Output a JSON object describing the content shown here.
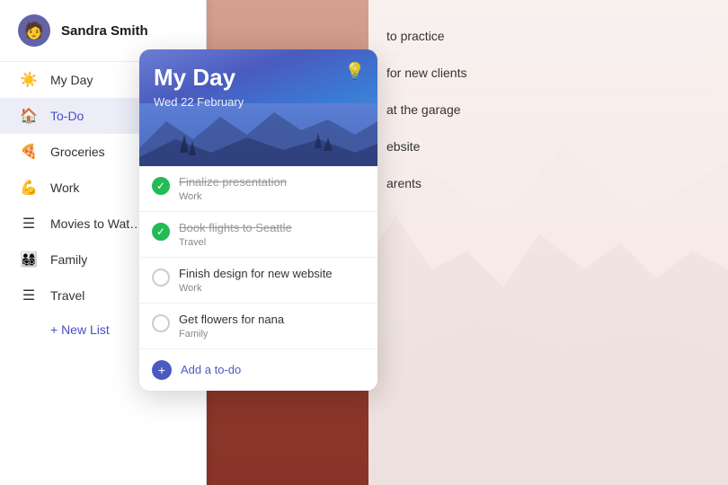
{
  "user": {
    "name": "Sandra Smith",
    "avatar_emoji": "🧑"
  },
  "sidebar": {
    "items": [
      {
        "id": "my-day",
        "label": "My Day",
        "icon": "☀️",
        "active": false
      },
      {
        "id": "to-do",
        "label": "To-Do",
        "icon": "🏠",
        "active": true
      },
      {
        "id": "groceries",
        "label": "Groceries",
        "icon": "🍕",
        "active": false
      },
      {
        "id": "work",
        "label": "Work",
        "icon": "💪",
        "active": false
      },
      {
        "id": "movies-to-watch",
        "label": "Movies to Wat…",
        "icon": "≡",
        "active": false
      },
      {
        "id": "family",
        "label": "Family",
        "icon": "👨‍👩‍👧‍👦",
        "active": false
      },
      {
        "id": "travel",
        "label": "Travel",
        "icon": "≡",
        "active": false
      },
      {
        "id": "new-list",
        "label": "+ New List",
        "icon": "",
        "active": false,
        "special": true
      }
    ]
  },
  "main_bg_tasks": [
    {
      "text": "to practice"
    },
    {
      "text": "for new clients"
    },
    {
      "text": "at the garage"
    },
    {
      "text": "ebsite"
    },
    {
      "text": "arents"
    }
  ],
  "card": {
    "title": "My Day",
    "date": "Wed 22 February",
    "bulb_icon": "💡",
    "tasks": [
      {
        "id": "task-1",
        "text": "Finalize presentation",
        "category": "Work",
        "done": true,
        "strikethrough": true
      },
      {
        "id": "task-2",
        "text": "Book flights to Seattle",
        "category": "Travel",
        "done": true,
        "strikethrough": true
      },
      {
        "id": "task-3",
        "text": "Finish design for new website",
        "category": "Work",
        "done": false,
        "strikethrough": false
      },
      {
        "id": "task-4",
        "text": "Get flowers for nana",
        "category": "Family",
        "done": false,
        "strikethrough": false
      }
    ],
    "add_label": "Add a to-do",
    "add_icon": "+"
  }
}
